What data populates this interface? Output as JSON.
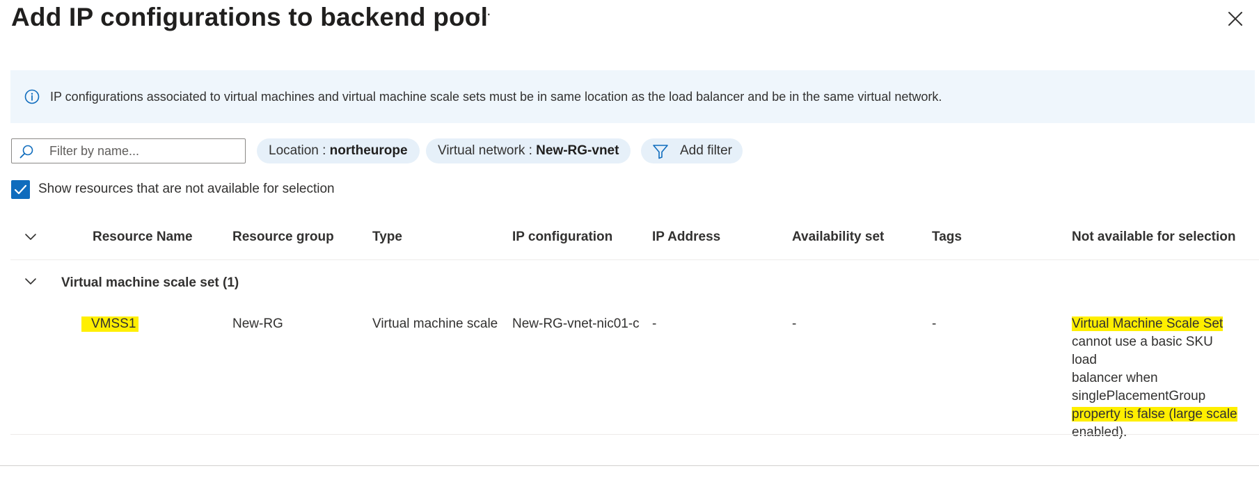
{
  "panel": {
    "title": "Add IP configurations to backend pool",
    "more_label": "···"
  },
  "info_bar": {
    "text": "IP configurations associated to virtual machines and virtual machine scale sets must be in same location as the load balancer and be in the same virtual network."
  },
  "filters": {
    "search_placeholder": "Filter by name...",
    "search_value": "",
    "location_label": "Location : ",
    "location_value": "northeurope",
    "vnet_label": "Virtual network : ",
    "vnet_value": "New-RG-vnet",
    "add_filter_label": "Add filter"
  },
  "show_unavailable": {
    "checked": true,
    "label": "Show resources that are not available for selection"
  },
  "table": {
    "columns": [
      "Resource Name",
      "Resource group",
      "Type",
      "IP configuration",
      "IP Address",
      "Availability set",
      "Tags",
      "Not available for selection"
    ],
    "groups": [
      {
        "label": "Virtual machine scale set (1)",
        "rows": [
          {
            "resource_name": "VMSS1",
            "resource_group": "New-RG",
            "type": "Virtual machine scale",
            "ip_configuration": "New-RG-vnet-nic01-c",
            "ip_address": "-",
            "availability_set": "-",
            "tags": "-",
            "not_available_reason": [
              "Virtual Machine Scale Set",
              "cannot use a basic SKU load",
              "balancer when",
              "singlePlacementGroup",
              "property is false (large scale",
              "enabled)."
            ]
          }
        ]
      }
    ]
  },
  "icons": {
    "more": "more-icon",
    "close": "close-icon",
    "info": "info-icon",
    "search": "search-icon",
    "filter": "filter-icon",
    "checkmark": "checkmark-icon",
    "chevron": "chevron-down-icon"
  },
  "colors": {
    "accent": "#0f6cbd",
    "info_background": "#eff6fc",
    "pill_background": "#e6f0f9",
    "highlight": "#ffef00"
  }
}
